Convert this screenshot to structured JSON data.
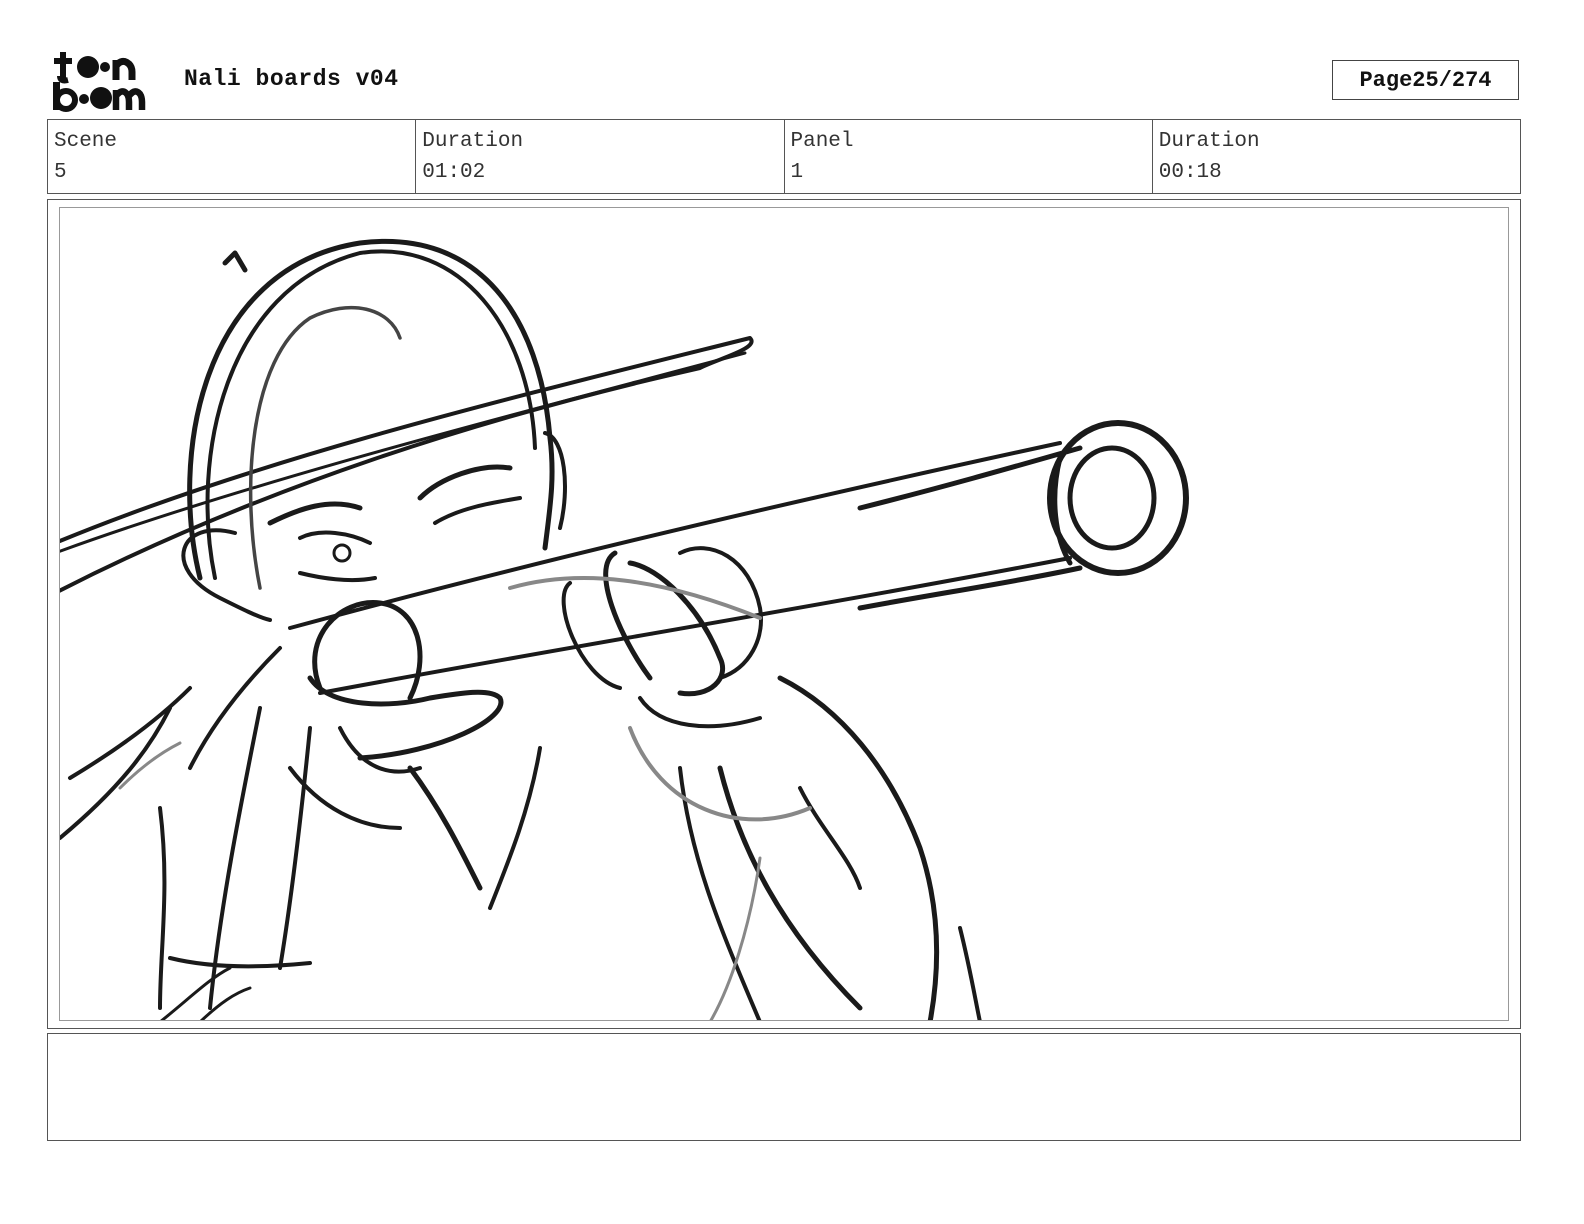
{
  "header": {
    "logo_icon": "toon-boom-logo",
    "project_title": "Nali boards v04",
    "page_label": "Page",
    "page_value": "25/274"
  },
  "info": {
    "scene_label": "Scene",
    "scene_value": "5",
    "scene_duration_label": "Duration",
    "scene_duration_value": "01:02",
    "panel_label": "Panel",
    "panel_value": "1",
    "panel_duration_label": "Duration",
    "panel_duration_value": "00:18"
  },
  "panel": {
    "image_icon": "storyboard-sketch-character-with-telescope"
  },
  "notes": {
    "text": ""
  }
}
